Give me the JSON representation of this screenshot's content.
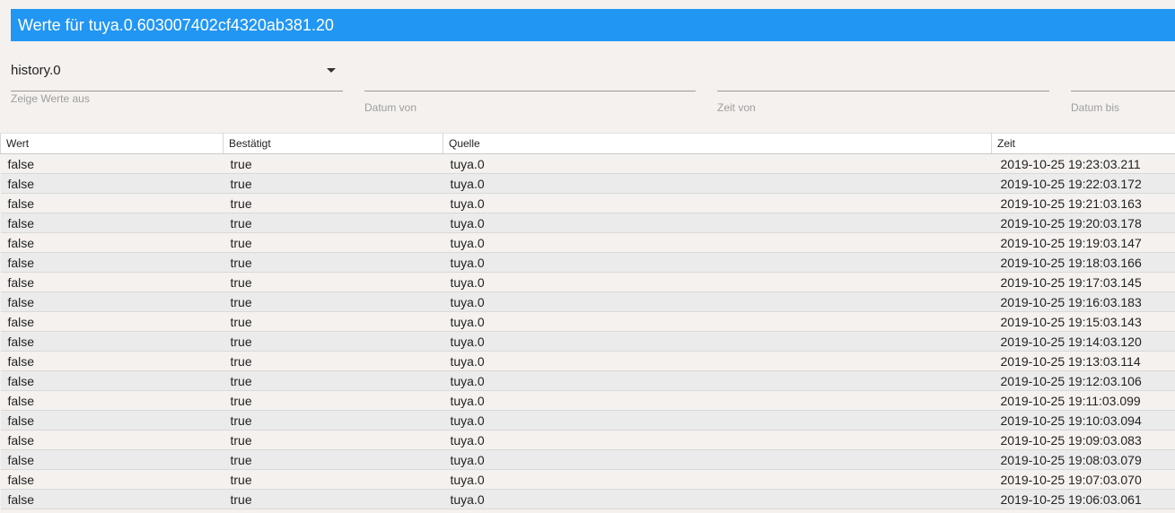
{
  "dialog": {
    "title": "Werte für tuya.0.603007402cf4320ab381.20"
  },
  "filters": {
    "instance": {
      "value": "history.0",
      "label": "Zeige Werte aus"
    },
    "date_from": {
      "value": "",
      "label": "Datum von"
    },
    "time_from": {
      "value": "",
      "label": "Zeit von"
    },
    "date_to": {
      "value": "",
      "label": "Datum bis"
    }
  },
  "table": {
    "headers": [
      "Wert",
      "Bestätigt",
      "Quelle",
      "Zeit"
    ],
    "rows": [
      [
        "false",
        "true",
        "tuya.0",
        "2019-10-25 19:23:03.211"
      ],
      [
        "false",
        "true",
        "tuya.0",
        "2019-10-25 19:22:03.172"
      ],
      [
        "false",
        "true",
        "tuya.0",
        "2019-10-25 19:21:03.163"
      ],
      [
        "false",
        "true",
        "tuya.0",
        "2019-10-25 19:20:03.178"
      ],
      [
        "false",
        "true",
        "tuya.0",
        "2019-10-25 19:19:03.147"
      ],
      [
        "false",
        "true",
        "tuya.0",
        "2019-10-25 19:18:03.166"
      ],
      [
        "false",
        "true",
        "tuya.0",
        "2019-10-25 19:17:03.145"
      ],
      [
        "false",
        "true",
        "tuya.0",
        "2019-10-25 19:16:03.183"
      ],
      [
        "false",
        "true",
        "tuya.0",
        "2019-10-25 19:15:03.143"
      ],
      [
        "false",
        "true",
        "tuya.0",
        "2019-10-25 19:14:03.120"
      ],
      [
        "false",
        "true",
        "tuya.0",
        "2019-10-25 19:13:03.114"
      ],
      [
        "false",
        "true",
        "tuya.0",
        "2019-10-25 19:12:03.106"
      ],
      [
        "false",
        "true",
        "tuya.0",
        "2019-10-25 19:11:03.099"
      ],
      [
        "false",
        "true",
        "tuya.0",
        "2019-10-25 19:10:03.094"
      ],
      [
        "false",
        "true",
        "tuya.0",
        "2019-10-25 19:09:03.083"
      ],
      [
        "false",
        "true",
        "tuya.0",
        "2019-10-25 19:08:03.079"
      ],
      [
        "false",
        "true",
        "tuya.0",
        "2019-10-25 19:07:03.070"
      ],
      [
        "false",
        "true",
        "tuya.0",
        "2019-10-25 19:06:03.061"
      ]
    ]
  },
  "colors": {
    "title_bar": "#2196f3",
    "background": "#f5f1ee",
    "row_alt": "#ebebeb"
  },
  "icons": {
    "instance_dropdown": "caret-down-icon"
  }
}
